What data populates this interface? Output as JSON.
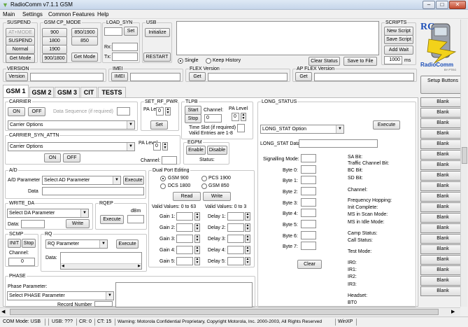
{
  "window": {
    "title": "RadioComm v7.1.1 GSM",
    "min": "–",
    "max": "□",
    "close": "✕"
  },
  "menu": [
    "Main",
    "Settings",
    "Common Features",
    "Help"
  ],
  "suspend": {
    "title": "SUSPEND",
    "at_mode": "AT+MODE",
    "suspend": "SUSPEND",
    "normal": "Normal",
    "get_mode": "Get Mode"
  },
  "cp_mode": {
    "title": "GSM CP_MODE",
    "b900": "900",
    "b850_1900": "850/1900",
    "b1800": "1800",
    "b850": "850",
    "b1900": "1900",
    "b900_1800": "900/1800",
    "get_mode": "Get Mode"
  },
  "load_syn": {
    "title": "LOAD_SYN",
    "set": "Set",
    "rx": "Rx:",
    "tx": "Tx:"
  },
  "usb": {
    "title": "USB",
    "initialize": "Initialize",
    "restart": "RESTART"
  },
  "log": {
    "single": "Single",
    "keep_history": "Keep History",
    "clear_status": "Clear Status",
    "save_to_file": "Save to File"
  },
  "scripts": {
    "title": "SCRIPTS",
    "new_script": "New Script",
    "save_script": "Save Script",
    "add_wait": "Add Wait",
    "wait_value": "1000",
    "wait_unit": "ms"
  },
  "logo": {
    "line1": "RadioComm",
    "line2": "BY PTEG",
    "rc": "RC"
  },
  "setup_buttons": "Setup Buttons",
  "blank_buttons": [
    "Blank",
    "Blank",
    "Blank",
    "Blank",
    "Blank",
    "Blank",
    "Blank",
    "Blank",
    "Blank",
    "Blank",
    "Blank",
    "Blank",
    "Blank",
    "Blank",
    "Blank",
    "Blank",
    "Blank",
    "Blank",
    "Blank"
  ],
  "version": {
    "title": "VERSION",
    "button": "Version"
  },
  "imei": {
    "title": "IMEI",
    "button": "IMEI"
  },
  "flex_version": {
    "title": "FLEX Version",
    "button": "Get"
  },
  "ap_flex_version": {
    "title": "AP FLEX Version",
    "button": "Get"
  },
  "tabs": [
    "GSM 1",
    "GSM 2",
    "GSM 3",
    "CIT",
    "TESTS"
  ],
  "carrier": {
    "title": "CARRIER",
    "on": "ON",
    "off": "OFF",
    "data_seq": "Data Sequence (if required)",
    "options": "Carrier Options"
  },
  "set_rf_pwr": {
    "title": "SET_RF_PWR",
    "pa_level": "PA Level",
    "value": "0",
    "set": "Set"
  },
  "tlpb": {
    "title": "TLPB",
    "start": "Start",
    "stop": "Stop",
    "channel": "Channel:",
    "channel_value": "0",
    "pa_level": "PA Level",
    "pa_value": "0",
    "time_slot": "Time Slot (if required)",
    "valid": "Valid Entries are 1-8"
  },
  "carrier_syn_attn": {
    "title": "CARRIER_SYN_ATTN",
    "options": "Carrier Options",
    "pa_level": "PA Level",
    "value": "0",
    "on": "ON",
    "off": "OFF",
    "channel": "Channel:"
  },
  "egpm": {
    "title": "EGPM",
    "enable": "Enable",
    "disable": "Disable",
    "status": "Status:"
  },
  "ad": {
    "title": "A/D",
    "parameter": "A/D Parameter",
    "select": "Select AD Parameter",
    "execute": "Execute",
    "data": "Data"
  },
  "dual_port": {
    "title": "Dual Port Editing",
    "gsm900": "GSM 900",
    "pcs1900": "PCS 1900",
    "dcs1800": "DCS 1800",
    "gsm850": "GSM 850",
    "read": "Read",
    "write": "Write",
    "valid_gain": "Valid Values: 0 to 63",
    "valid_delay": "Valid Values: 0 to 3",
    "gains": [
      "Gain 1:",
      "Gain 2:",
      "Gain 3:",
      "Gain 4:",
      "Gain 5:"
    ],
    "delays": [
      "Delay 1:",
      "Delay 2:",
      "Delay 3:",
      "Delay 4:",
      "Delay 5:"
    ]
  },
  "write_da": {
    "title": "WRITE_DA",
    "select": "Select DA Parameter",
    "data": "Data:",
    "write": "Write"
  },
  "rqep": {
    "title": "RQEP",
    "dbm": "dBm",
    "execute": "Execute"
  },
  "scmp": {
    "title": "SCMP",
    "init": "INIT",
    "stop": "Stop",
    "channel": "Channel:",
    "channel_value": "0"
  },
  "rq": {
    "title": "RQ",
    "select": "RQ Parameter",
    "execute": "Execute",
    "data": "Data:"
  },
  "phase": {
    "title": "PHASE",
    "parameter": "Phase Parameter:",
    "select": "Select PHASE Parameter",
    "record_number": "Record Number"
  },
  "long_status": {
    "title": "LONG_STATUS",
    "option": "LONG_STAT Option",
    "execute": "Execute",
    "data": "LONG_STAT Data:",
    "signalling": "Signalling Mode:",
    "bytes": [
      "Byte 0:",
      "Byte 1:",
      "Byte 2:",
      "Byte 3:",
      "Byte 4:",
      "Byte 5:",
      "Byte 6:",
      "Byte 7:"
    ],
    "clear": "Clear",
    "bits": [
      "SA Bit:",
      "Traffic Channel Bit:",
      "BC Bit:",
      "SD Bit:"
    ],
    "channel": "Channel:",
    "freq_hopping": "Frequency Hopping:",
    "init_complete": "Init Complete:",
    "scan_mode": "MS in Scan Mode:",
    "idle_mode": "MS in Idle Mode:",
    "camp_status": "Camp Status:",
    "call_status": "Call Status:",
    "test_mode": "Test Mode:",
    "ird": [
      "IR0:",
      "IR1:",
      "IR2:",
      "IR3:"
    ],
    "headset": "Headset:",
    "bt0": "BT0"
  },
  "status_bar": {
    "com_mode": "COM Mode: USB",
    "usb": "USB: ???",
    "cr": "CR: 0",
    "ct": "CT: 15",
    "warning": "Warning: Motorola Confidential Proprietary, Copyright Motorola, Inc. 2000-2003, All Rights Reserved",
    "os": "WinXP"
  }
}
